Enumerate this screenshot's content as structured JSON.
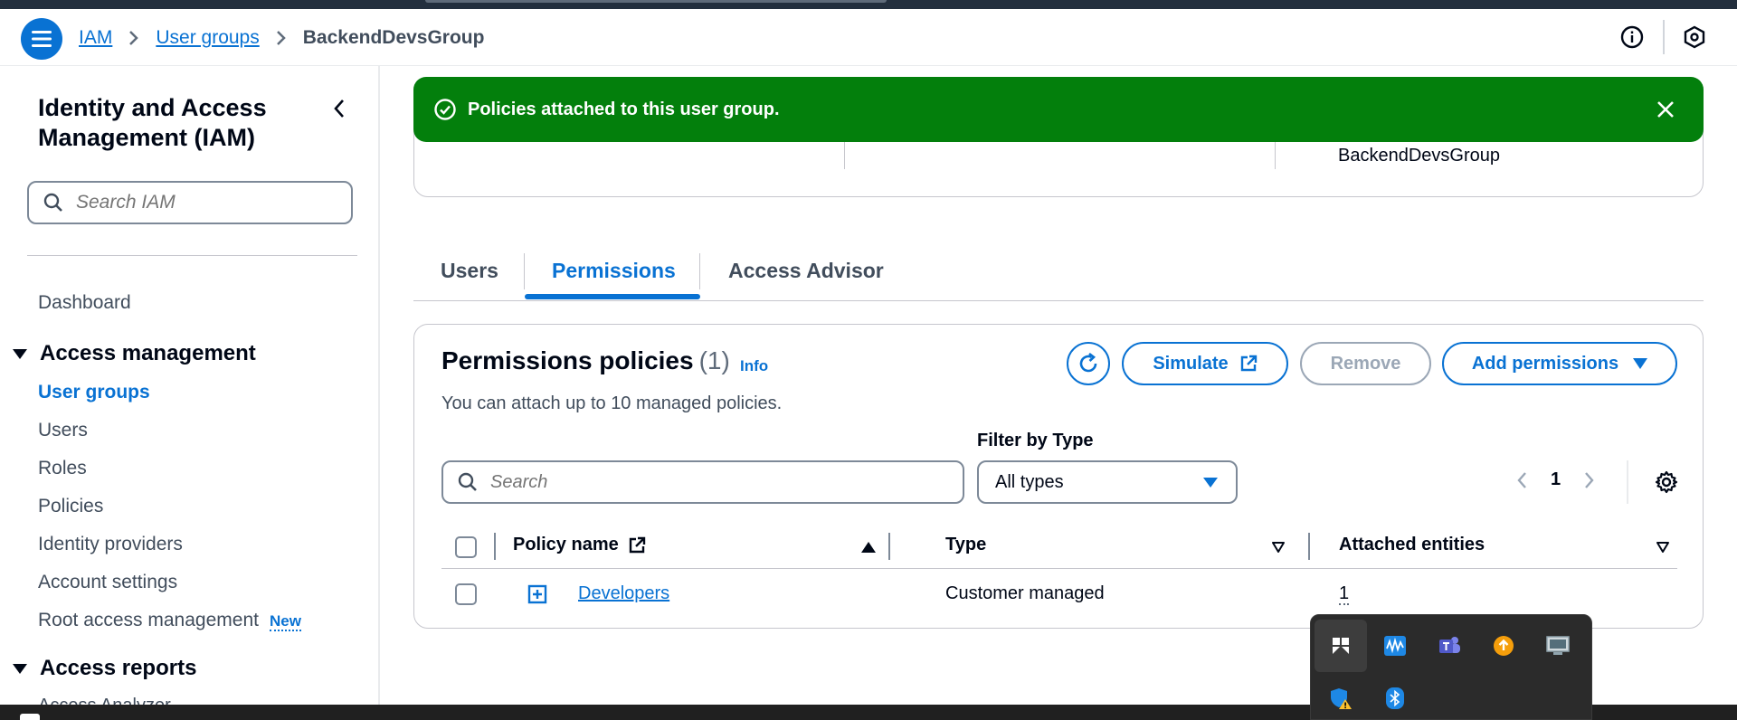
{
  "header": {
    "breadcrumbs": [
      "IAM",
      "User groups"
    ],
    "current": "BackendDevsGroup"
  },
  "sidebar": {
    "title": "Identity and Access Management (IAM)",
    "search_placeholder": "Search IAM",
    "dashboard": "Dashboard",
    "section_access_management": "Access management",
    "items": [
      "User groups",
      "Users",
      "Roles",
      "Policies",
      "Identity providers",
      "Account settings",
      "Root access management"
    ],
    "new_badge": "New",
    "section_access_reports": "Access reports",
    "peek_item": "Access Analyzer"
  },
  "flash": {
    "message": "Policies attached to this user group.",
    "type": "success"
  },
  "details": {
    "group_name_value": "BackendDevsGroup"
  },
  "tabs": [
    "Users",
    "Permissions",
    "Access Advisor"
  ],
  "active_tab": "Permissions",
  "permissions": {
    "title": "Permissions policies",
    "count": "(1)",
    "info": "Info",
    "description": "You can attach up to 10 managed policies.",
    "simulate_label": "Simulate",
    "remove_label": "Remove",
    "add_label": "Add permissions",
    "filter_label": "Filter by Type",
    "search_placeholder": "Search",
    "filter_value": "All types",
    "page": "1",
    "columns": [
      "Policy name",
      "Type",
      "Attached entities"
    ],
    "rows": [
      {
        "policy_name": "Developers",
        "type": "Customer managed",
        "attached_entities": "1"
      }
    ]
  },
  "colors": {
    "accent": "#0972d3",
    "success": "#037f0c",
    "disabled": "#9ba7b6"
  },
  "tray_icons": [
    "pin-app-icon",
    "audio-app-icon",
    "teams-icon",
    "update-icon",
    "display-icon",
    "security-warning-icon",
    "bluetooth-icon"
  ]
}
